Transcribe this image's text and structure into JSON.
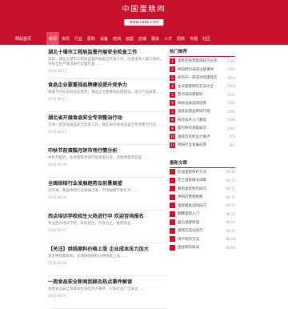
{
  "header": {
    "brand": "中国蛋糕网",
    "sub": "www.cake.com"
  },
  "nav": {
    "home": "网站首页",
    "items": [
      "新闻",
      "资讯",
      "行业",
      "原料",
      "设备",
      "培训",
      "加盟",
      "店铺",
      "展会",
      "人才",
      "招商",
      "专题",
      "社区"
    ]
  },
  "articles": [
    {
      "title": "湖北十堰市工程局监督开展安全检查工作",
      "summary": "日前，湖北十堰市工程局监督开展安全检查工作，检查组深入施工现场，对安全生产情况进行全面检查……",
      "date": "2016-08-12"
    },
    {
      "title": "食品企业要重视品牌建设提升竞争力",
      "summary": "随着市场竞争的日益激烈，食品企业要重视品牌建设，提升产品质量……",
      "date": "2016-08-11"
    },
    {
      "title": "湖北省开展食品安全专项整治行动",
      "summary": "为进一步加强食品安全监管工作，湖北省开展食品安全专项整治行动……",
      "date": "2016-08-10"
    },
    {
      "title": "中秋节前蛋糕月饼市场行情分析",
      "summary": "中秋节临近，各地蛋糕月饼市场逐渐升温，消费者需求旺盛……",
      "date": "2016-08-09"
    },
    {
      "title": "全国烘焙行业发展趋势及前景展望",
      "summary": "近年来，我国烘焙行业发展迅速，市场规模不断扩大……",
      "date": "2016-08-08"
    },
    {
      "title": "西点培训学校招生火热进行中 欢迎咨询报名",
      "summary": "专业西点培训学校，常年招生，学会为止，推荐就业……",
      "date": "2016-08-07"
    },
    {
      "title": "【关注】烘焙原料价格上涨 企业成本压力加大",
      "summary": "受多种因素影响，近期烘焙原料价格持续上涨……",
      "date": "2016-08-06"
    },
    {
      "title": "一周食品安全新闻回顾及热点事件解读",
      "summary": "本周食品安全领域发生多起热点事件，引发社会广泛关注……",
      "date": "2016-08-05"
    }
  ],
  "sidebar": {
    "hot_title": "热门推荐",
    "hot": [
      {
        "text": "蛋糕店经营管理技巧分享",
        "count": "2342"
      },
      {
        "text": "烘焙原料采购注意事项",
        "count": "1987"
      },
      {
        "text": "如何开一家成功的蛋糕店",
        "count": "1876"
      },
      {
        "text": "生日蛋糕制作方法大全",
        "count": "1654"
      },
      {
        "text": "西点培训哪家好",
        "count": "1532"
      },
      {
        "text": "烘焙设备选购指南",
        "count": "1421"
      },
      {
        "text": "蛋糕加盟品牌排行榜",
        "count": "1309"
      },
      {
        "text": "裱花技术入门教程",
        "count": "1198"
      },
      {
        "text": "面包制作基础知识",
        "count": "1087"
      },
      {
        "text": "蛋糕店装修设计要点",
        "count": "976"
      },
      {
        "text": "烘焙行业发展前景",
        "count": "865"
      }
    ],
    "latest_title": "最新文章",
    "latest": [
      {
        "text": "奶油蛋糕保存方法",
        "count": "08-12"
      },
      {
        "text": "芝士蛋糕做法详解",
        "count": "08-12"
      },
      {
        "text": "慕斯蛋糕制作技巧",
        "count": "08-11"
      },
      {
        "text": "烘焙店营销策略",
        "count": "08-11"
      },
      {
        "text": "蛋糕模具选购技巧",
        "count": "08-10"
      },
      {
        "text": "翻糖蛋糕入门",
        "count": "08-10"
      },
      {
        "text": "面包发酵原理",
        "count": "08-09"
      },
      {
        "text": "蛋糕店选址技巧",
        "count": "08-09"
      },
      {
        "text": "饼干制作方法",
        "count": "08-08"
      },
      {
        "text": "蛋挞制作秘诀",
        "count": "08-08"
      }
    ]
  }
}
